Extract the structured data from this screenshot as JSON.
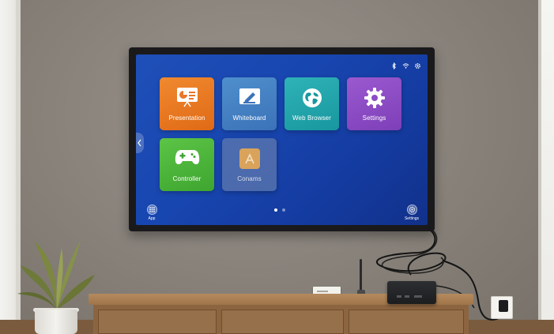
{
  "screen": {
    "status_icons": [
      "bluetooth-icon",
      "wifi-icon",
      "gear-icon"
    ],
    "tiles": [
      {
        "label": "Presentation",
        "icon": "presentation-icon",
        "color": "#e8772a"
      },
      {
        "label": "Whiteboard",
        "icon": "whiteboard-icon",
        "color": "#4682c4"
      },
      {
        "label": "Web Browser",
        "icon": "globe-icon",
        "color": "#22a5ab"
      },
      {
        "label": "Settings",
        "icon": "gear-icon",
        "color": "#8b4cc4"
      },
      {
        "label": "Controller",
        "icon": "gamepad-icon",
        "color": "#4cb63b"
      },
      {
        "label": "Conams",
        "icon": "app-icon",
        "color": "#7f8ca8"
      }
    ],
    "page_indicator": {
      "pages": 2,
      "current": 1
    },
    "dock": {
      "app_label": "App",
      "settings_label": "Settings"
    }
  }
}
